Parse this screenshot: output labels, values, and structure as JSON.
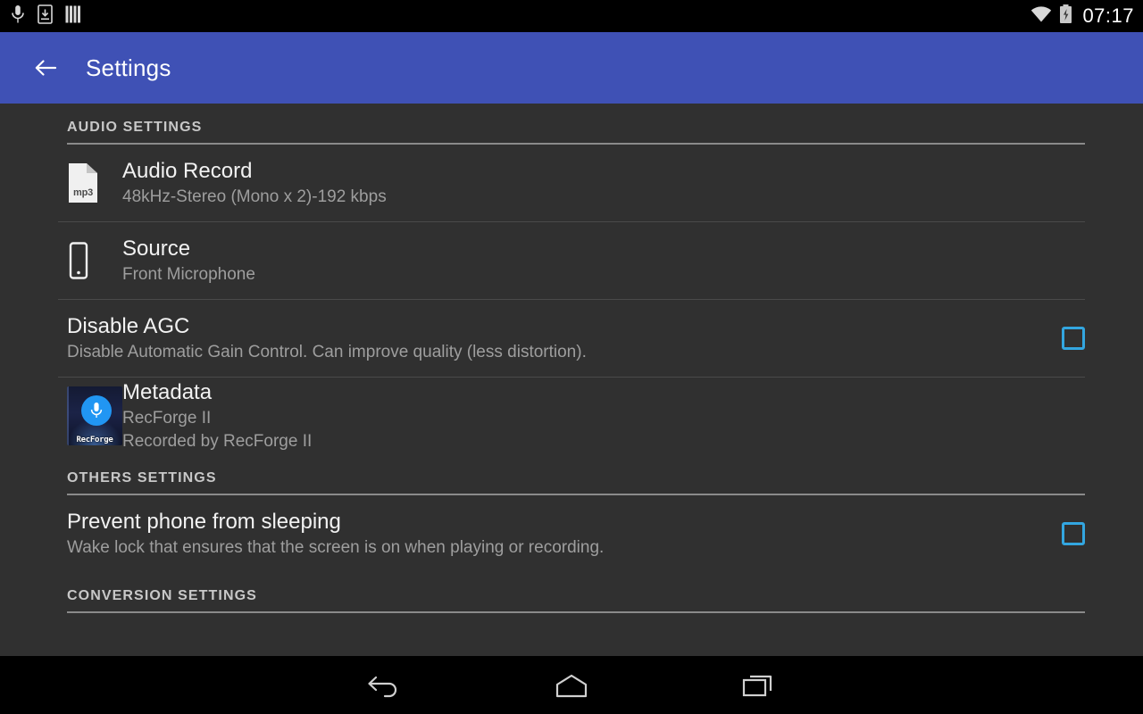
{
  "status_bar": {
    "icons_left": [
      "microphone-icon",
      "download-icon",
      "equalizer-icon"
    ],
    "icons_right": [
      "wifi-icon",
      "battery-charging-icon"
    ],
    "clock": "07:17"
  },
  "action_bar": {
    "back_icon": "back-arrow-icon",
    "title": "Settings"
  },
  "sections": [
    {
      "header": "AUDIO SETTINGS",
      "items": [
        {
          "icon": "mp3-file-icon",
          "icon_label": "mp3",
          "title": "Audio Record",
          "subtitle": "48kHz-Stereo (Mono x 2)-192 kbps",
          "checkbox": null
        },
        {
          "icon": "phone-icon",
          "title": "Source",
          "subtitle": "Front Microphone",
          "checkbox": null
        },
        {
          "icon": null,
          "title": "Disable AGC",
          "subtitle": "Disable Automatic Gain Control. Can improve quality (less distortion).",
          "checkbox": "unchecked"
        },
        {
          "icon": "recforge-album-art",
          "icon_label": "RecForge",
          "title": "Metadata",
          "subtitle": "RecForge II",
          "subtitle2": "Recorded by RecForge II",
          "checkbox": null
        }
      ]
    },
    {
      "header": "OTHERS SETTINGS",
      "items": [
        {
          "icon": null,
          "title": "Prevent phone from sleeping",
          "subtitle": "Wake lock that ensures that the screen is on when playing or recording.",
          "checkbox": "unchecked"
        }
      ]
    },
    {
      "header": "CONVERSION SETTINGS",
      "items": []
    }
  ],
  "nav_bar": {
    "back": "nav-back-icon",
    "home": "nav-home-icon",
    "recents": "nav-recents-icon"
  },
  "colors": {
    "accent_blue": "#3F51B5",
    "checkbox_blue": "#33A6E0",
    "background": "#303030",
    "nav_background": "#000000",
    "title_text": "#f2f2f2",
    "subtitle_text": "#9e9e9e",
    "section_header_text": "#c8c8c8"
  }
}
